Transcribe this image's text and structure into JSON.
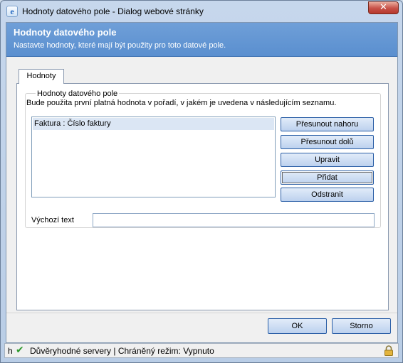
{
  "window": {
    "title": "Hodnoty datového pole - Dialog webové stránky",
    "close_glyph": "✕"
  },
  "header": {
    "title": "Hodnoty datového pole",
    "subtitle": "Nastavte hodnoty, které mají být použity pro toto datové pole."
  },
  "tabs": [
    {
      "label": "Hodnoty",
      "selected": true
    }
  ],
  "group": {
    "legend": "Hodnoty datového pole",
    "description": "Bude použita první platná hodnota v pořadí, v jakém je uvedena v následujícím seznamu.",
    "list_items": [
      "Faktura : Číslo faktury"
    ],
    "selected_index": 0,
    "buttons": {
      "move_up": "Přesunout nahoru",
      "move_down": "Přesunout dolů",
      "edit": "Upravit",
      "add": "Přidat",
      "remove": "Odstranit"
    }
  },
  "default_text": {
    "label": "Výchozí text",
    "value": ""
  },
  "footer": {
    "ok": "OK",
    "cancel": "Storno"
  },
  "statusbar": {
    "prefix": "h",
    "text": "Důvěryhodné servery | Chráněný režim: Vypnuto",
    "icons": [
      "check-icon",
      "lock-icon"
    ]
  },
  "colors": {
    "header_bg": "#5a8fcf",
    "button_border": "#2a5ea6",
    "selection_bg": "#dbe6f4"
  }
}
